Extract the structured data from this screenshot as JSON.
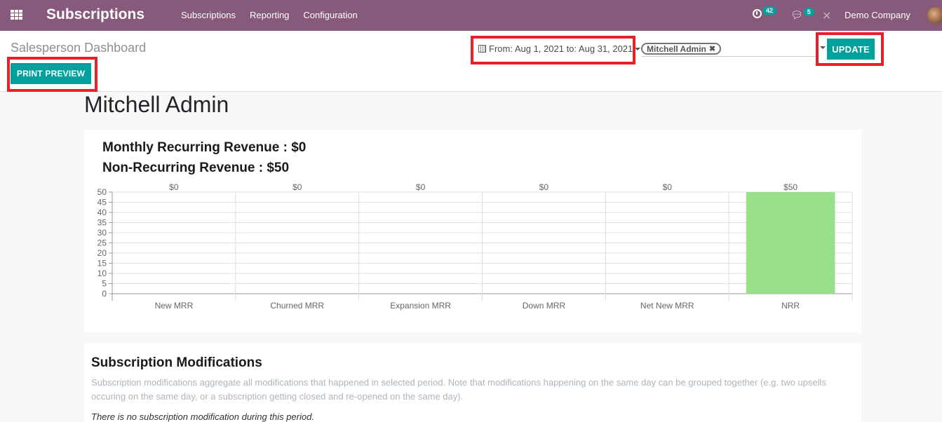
{
  "navbar": {
    "app_title": "Subscriptions",
    "menu": [
      "Subscriptions",
      "Reporting",
      "Configuration"
    ],
    "activity_count": "42",
    "messages_count": "5",
    "company": "Demo Company",
    "icons": {
      "apps": "apps-grid-icon",
      "activity": "clock-icon",
      "messages": "chat-icon",
      "debug": "tools-icon",
      "user": "avatar"
    }
  },
  "control": {
    "breadcrumb": "Salesperson Dashboard",
    "print_preview_label": "PRINT PREVIEW",
    "date_range": "From: Aug 1, 2021 to: Aug 31, 2021",
    "filter_tag": "Mitchell Admin",
    "update_label": "UPDATE"
  },
  "main": {
    "salesperson_name": "Mitchell Admin",
    "mrr_line": "Monthly Recurring Revenue : $0",
    "nrr_line": "Non-Recurring Revenue : $50",
    "modifications": {
      "title": "Subscription Modifications",
      "description": "Subscription modifications aggregate all modifications that happened in selected period. Note that modifications happening on the same day can be grouped together (e.g. two upsells occuring on the same day, or a subscription getting closed and re-opened on the same day).",
      "empty_message": "There is no subscription modification during this period."
    }
  },
  "colors": {
    "navbar": "#875a7b",
    "primary": "#00a09d",
    "highlight": "#e8202a",
    "bar": "#98df8a"
  },
  "chart_data": {
    "type": "bar",
    "title": "",
    "xlabel": "",
    "ylabel": "",
    "categories": [
      "New MRR",
      "Churned MRR",
      "Expansion MRR",
      "Down MRR",
      "Net New MRR",
      "NRR"
    ],
    "values": [
      0,
      0,
      0,
      0,
      0,
      50
    ],
    "data_labels": [
      "$0",
      "$0",
      "$0",
      "$0",
      "$0",
      "$50"
    ],
    "ylim": [
      0,
      50
    ],
    "yticks": [
      0,
      5,
      10,
      15,
      20,
      25,
      30,
      35,
      40,
      45,
      50
    ],
    "grid": true,
    "legend": "none"
  }
}
